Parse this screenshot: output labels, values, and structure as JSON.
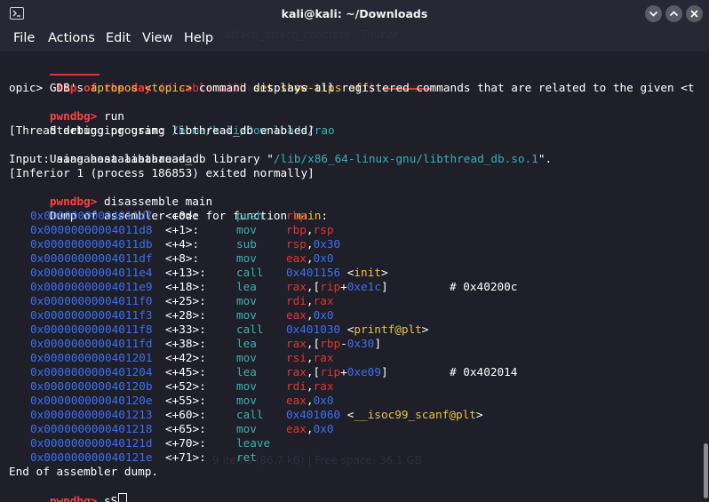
{
  "window": {
    "title": "kali@kali: ~/Downloads"
  },
  "menu": [
    "File",
    "Actions",
    "Edit",
    "View",
    "Help"
  ],
  "ghost": {
    "top1": "attach_attach_concrete - Thunar",
    "top2": "... Downloads   return_address_overwrite",
    "bottom": "9 items (86.7 kB) | Free space: 36.1 GB"
  },
  "tip": {
    "title": "tip of the day",
    "hint_prefix": "(disable with ",
    "hint_cmd": "set show-tips off",
    "hint_suffix": ")",
    "line1_a": "GDB's ",
    "line1_b": "apropos",
    "line1_c": " ",
    "line1_d": "<topic>",
    "line1_e": " command displays all registered commands that are related to the given <t",
    "line2": "opic>"
  },
  "prompt": "pwndbg>",
  "session": {
    "cmd1": " run",
    "starting_label": "Starting program: ",
    "starting_path": "/home/kali/Downloads/rao",
    "thread_debug": "[Thread debugging using libthread_db enabled]",
    "host_lib_label": "Using host libthread_db library \"",
    "host_lib_path": "/lib/x86_64-linux-gnu/libthread_db.so.1",
    "host_lib_end": "\".",
    "input_line": "Input: aaaaaaaaaaaaaaaaaaaa",
    "exit_line": "[Inferior 1 (process 186853) exited normally]",
    "cmd2": " disassemble main",
    "dump_label": "Dump of assembler code for function ",
    "dump_fn": "main",
    "dump_end": ":",
    "end_dump": "End of assembler dump.",
    "cmd3": " sS"
  },
  "instructions": [
    {
      "addr": "0x00000000004011d7",
      "off": "<+0>:",
      "mn": "push",
      "ops": [
        [
          "rbp",
          "red"
        ]
      ],
      "cmt": ""
    },
    {
      "addr": "0x00000000004011d8",
      "off": "<+1>:",
      "mn": "mov",
      "ops": [
        [
          "rbp",
          "red"
        ],
        [
          ",",
          "white"
        ],
        [
          "rsp",
          "red"
        ]
      ],
      "cmt": ""
    },
    {
      "addr": "0x00000000004011db",
      "off": "<+4>:",
      "mn": "sub",
      "ops": [
        [
          "rsp",
          "red"
        ],
        [
          ",",
          "white"
        ],
        [
          "0x30",
          "blue"
        ]
      ],
      "cmt": ""
    },
    {
      "addr": "0x00000000004011df",
      "off": "<+8>:",
      "mn": "mov",
      "ops": [
        [
          "eax",
          "red"
        ],
        [
          ",",
          "white"
        ],
        [
          "0x0",
          "blue"
        ]
      ],
      "cmt": ""
    },
    {
      "addr": "0x00000000004011e4",
      "off": "<+13>:",
      "mn": "call",
      "ops": [
        [
          "0x401156",
          "blue"
        ],
        [
          " <",
          "white"
        ],
        [
          "init",
          "yellow"
        ],
        [
          ">",
          "white"
        ]
      ],
      "cmt": ""
    },
    {
      "addr": "0x00000000004011e9",
      "off": "<+18>:",
      "mn": "lea",
      "ops": [
        [
          "rax",
          "red"
        ],
        [
          ",[",
          "white"
        ],
        [
          "rip",
          "red"
        ],
        [
          "+",
          "white"
        ],
        [
          "0xe1c",
          "blue"
        ],
        [
          "]",
          "white"
        ]
      ],
      "cmt": "# 0x40200c"
    },
    {
      "addr": "0x00000000004011f0",
      "off": "<+25>:",
      "mn": "mov",
      "ops": [
        [
          "rdi",
          "red"
        ],
        [
          ",",
          "white"
        ],
        [
          "rax",
          "red"
        ]
      ],
      "cmt": ""
    },
    {
      "addr": "0x00000000004011f3",
      "off": "<+28>:",
      "mn": "mov",
      "ops": [
        [
          "eax",
          "red"
        ],
        [
          ",",
          "white"
        ],
        [
          "0x0",
          "blue"
        ]
      ],
      "cmt": ""
    },
    {
      "addr": "0x00000000004011f8",
      "off": "<+33>:",
      "mn": "call",
      "ops": [
        [
          "0x401030",
          "blue"
        ],
        [
          " <",
          "white"
        ],
        [
          "printf@plt",
          "yellow"
        ],
        [
          ">",
          "white"
        ]
      ],
      "cmt": ""
    },
    {
      "addr": "0x00000000004011fd",
      "off": "<+38>:",
      "mn": "lea",
      "ops": [
        [
          "rax",
          "red"
        ],
        [
          ",[",
          "white"
        ],
        [
          "rbp",
          "red"
        ],
        [
          "-",
          "white"
        ],
        [
          "0x30",
          "blue"
        ],
        [
          "]",
          "white"
        ]
      ],
      "cmt": ""
    },
    {
      "addr": "0x0000000000401201",
      "off": "<+42>:",
      "mn": "mov",
      "ops": [
        [
          "rsi",
          "red"
        ],
        [
          ",",
          "white"
        ],
        [
          "rax",
          "red"
        ]
      ],
      "cmt": ""
    },
    {
      "addr": "0x0000000000401204",
      "off": "<+45>:",
      "mn": "lea",
      "ops": [
        [
          "rax",
          "red"
        ],
        [
          ",[",
          "white"
        ],
        [
          "rip",
          "red"
        ],
        [
          "+",
          "white"
        ],
        [
          "0xe09",
          "blue"
        ],
        [
          "]",
          "white"
        ]
      ],
      "cmt": "# 0x402014"
    },
    {
      "addr": "0x000000000040120b",
      "off": "<+52>:",
      "mn": "mov",
      "ops": [
        [
          "rdi",
          "red"
        ],
        [
          ",",
          "white"
        ],
        [
          "rax",
          "red"
        ]
      ],
      "cmt": ""
    },
    {
      "addr": "0x000000000040120e",
      "off": "<+55>:",
      "mn": "mov",
      "ops": [
        [
          "eax",
          "red"
        ],
        [
          ",",
          "white"
        ],
        [
          "0x0",
          "blue"
        ]
      ],
      "cmt": ""
    },
    {
      "addr": "0x0000000000401213",
      "off": "<+60>:",
      "mn": "call",
      "ops": [
        [
          "0x401060",
          "blue"
        ],
        [
          " <",
          "white"
        ],
        [
          "__isoc99_scanf@plt",
          "yellow"
        ],
        [
          ">",
          "white"
        ]
      ],
      "cmt": ""
    },
    {
      "addr": "0x0000000000401218",
      "off": "<+65>:",
      "mn": "mov",
      "ops": [
        [
          "eax",
          "red"
        ],
        [
          ",",
          "white"
        ],
        [
          "0x0",
          "blue"
        ]
      ],
      "cmt": ""
    },
    {
      "addr": "0x000000000040121d",
      "off": "<+70>:",
      "mn": "leave",
      "ops": [],
      "cmt": ""
    },
    {
      "addr": "0x000000000040121e",
      "off": "<+71>:",
      "mn": "ret",
      "ops": [],
      "cmt": ""
    }
  ],
  "colors": {
    "background": "#1e1f29",
    "titlebar": "#272834",
    "prompt": "#ff4040",
    "address": "#3e6ff0",
    "mnemonic": "#3cb0b0",
    "register": "#e03535",
    "symbol": "#e6c44a",
    "path": "#3cb0b0"
  },
  "icons": {
    "app": "terminal-icon",
    "minimize": "minimize-icon",
    "maximize": "maximize-icon",
    "close": "close-icon"
  }
}
